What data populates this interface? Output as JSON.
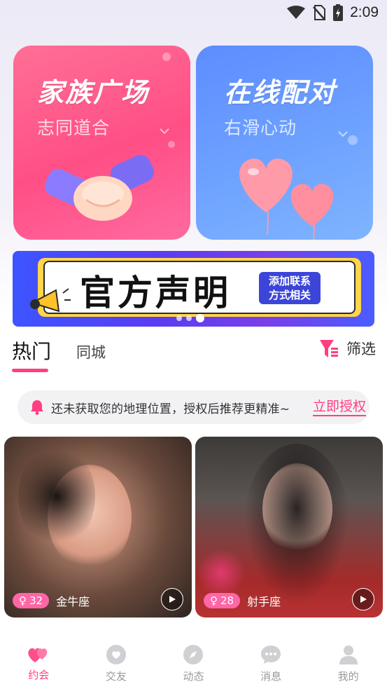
{
  "status_bar": {
    "time": "2:09"
  },
  "cards": [
    {
      "title": "家族广场",
      "subtitle": "志同道合"
    },
    {
      "title": "在线配对",
      "subtitle": "右滑心动"
    }
  ],
  "banner": {
    "title": "官方声明",
    "badge_line1": "添加联系",
    "badge_line2": "方式相关"
  },
  "tabs": {
    "hot": "热门",
    "city": "同城",
    "filter": "筛选"
  },
  "notice": {
    "text": "还未获取您的地理位置，授权后推荐更精准~",
    "link": "立即授权"
  },
  "profiles": [
    {
      "gender": "♀",
      "age": "32",
      "zodiac": "金牛座"
    },
    {
      "gender": "♀",
      "age": "28",
      "zodiac": "射手座"
    }
  ],
  "bottom_nav": [
    {
      "label": "约会",
      "icon": "hearts-icon",
      "active": true
    },
    {
      "label": "交友",
      "icon": "heart-bubble-icon",
      "active": false
    },
    {
      "label": "动态",
      "icon": "compass-icon",
      "active": false
    },
    {
      "label": "消息",
      "icon": "chat-icon",
      "active": false
    },
    {
      "label": "我的",
      "icon": "person-icon",
      "active": false
    }
  ],
  "colors": {
    "accent": "#ff3f80",
    "card_pink": "#ff4f86",
    "card_blue": "#6ea2ff"
  }
}
